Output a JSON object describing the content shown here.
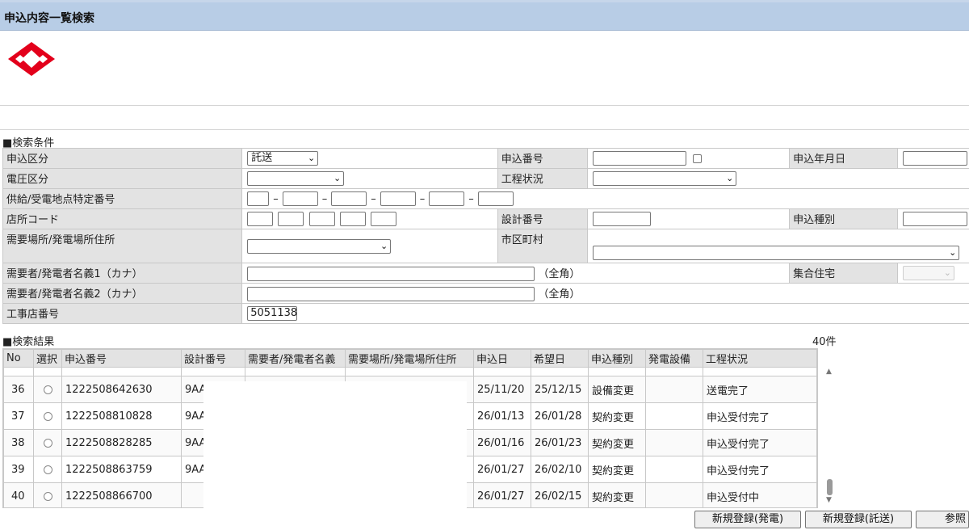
{
  "window": {
    "title": "申込内容一覧検索"
  },
  "colors": {
    "titlebar": "#b8cde6",
    "logo": "#e3001b"
  },
  "criteria": {
    "section_label": "■検索条件",
    "application_type": {
      "label": "申込区分",
      "selected": "託送"
    },
    "application_number": {
      "label": "申込番号",
      "value": ""
    },
    "application_date": {
      "label": "申込年月日",
      "value": ""
    },
    "voltage_type": {
      "label": "電圧区分",
      "selected": ""
    },
    "process_status": {
      "label": "工程状況",
      "selected": ""
    },
    "supply_point_number": {
      "label": "供給/受電地点特定番号"
    },
    "store_code": {
      "label": "店所コード"
    },
    "design_number": {
      "label": "設計番号",
      "value": ""
    },
    "application_kind": {
      "label": "申込種別",
      "value": ""
    },
    "site_address": {
      "label": "需要場所/発電場所住所",
      "selected": ""
    },
    "city": {
      "label": "市区町村",
      "selected": ""
    },
    "customer_name1": {
      "label": "需要者/発電者名義1（カナ）",
      "value": "",
      "note": "（全角）"
    },
    "customer_name2": {
      "label": "需要者/発電者名義2（カナ）",
      "value": "",
      "note": "（全角）"
    },
    "housing_complex": {
      "label": "集合住宅",
      "selected": ""
    },
    "contractor_number": {
      "label": "工事店番号",
      "value": "5051138"
    }
  },
  "results": {
    "section_label": "■検索結果",
    "count": "40件",
    "columns": [
      "No",
      "選択",
      "申込番号",
      "設計番号",
      "需要者/発電者名義",
      "需要場所/発電場所住所",
      "申込日",
      "希望日",
      "申込種別",
      "発電設備",
      "工程状況"
    ],
    "rows": [
      {
        "no": "36",
        "app_no": "1222508642630",
        "design": "9AA",
        "app_date": "25/11/20",
        "wish_date": "25/12/15",
        "kind": "設備変更",
        "facility": "",
        "status": "送電完了"
      },
      {
        "no": "37",
        "app_no": "1222508810828",
        "design": "9AA",
        "app_date": "26/01/13",
        "wish_date": "26/01/28",
        "kind": "契約変更",
        "facility": "",
        "status": "申込受付完了"
      },
      {
        "no": "38",
        "app_no": "1222508828285",
        "design": "9AA",
        "app_date": "26/01/16",
        "wish_date": "26/01/23",
        "kind": "契約変更",
        "facility": "",
        "status": "申込受付完了"
      },
      {
        "no": "39",
        "app_no": "1222508863759",
        "design": "9AA",
        "app_date": "26/01/27",
        "wish_date": "26/02/10",
        "kind": "契約変更",
        "facility": "",
        "status": "申込受付完了"
      },
      {
        "no": "40",
        "app_no": "1222508866700",
        "design": "",
        "app_date": "26/01/27",
        "wish_date": "26/02/15",
        "kind": "契約変更",
        "facility": "",
        "status": "申込受付中"
      }
    ]
  },
  "buttons": {
    "new_generation": "新規登録(発電)",
    "new_consignment": "新規登録(託送)",
    "reference": "参照"
  }
}
